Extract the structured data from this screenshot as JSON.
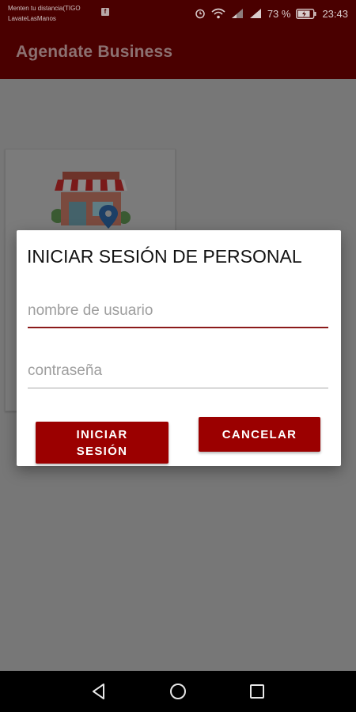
{
  "status_bar": {
    "carrier_line1": "Menten tu distancia(TIGO",
    "carrier_line2": "LavateLasManos",
    "notification_icon": "facebook-icon",
    "battery_percent": "73 %",
    "time": "23:43"
  },
  "app_bar": {
    "title": "Agendate Business"
  },
  "dialog": {
    "title": "INICIAR SESIÓN DE PERSONAL",
    "username_placeholder": "nombre de usuario",
    "password_placeholder": "contraseña",
    "login_label_line1": "INICIAR",
    "login_label_line2": "SESIÓN",
    "cancel_label": "CANCELAR"
  },
  "colors": {
    "brand_dark": "#4a0000",
    "accent": "#9b0000"
  },
  "nav_bar": {
    "back_icon": "back-triangle-icon",
    "home_icon": "home-circle-icon",
    "recents_icon": "recents-square-icon"
  }
}
